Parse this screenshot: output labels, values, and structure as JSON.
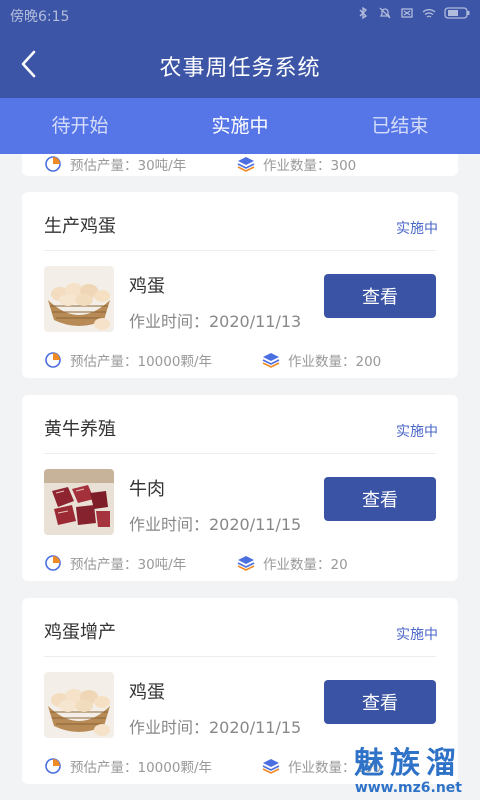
{
  "status_bar": {
    "time": "傍晚6:15"
  },
  "app_bar": {
    "title": "农事周任务系统"
  },
  "tabs": [
    {
      "label": "待开始",
      "active": false
    },
    {
      "label": "实施中",
      "active": true
    },
    {
      "label": "已结束",
      "active": false
    }
  ],
  "partial_card": {
    "yield_label": "预估产量：30吨/年",
    "quantity_label": "作业数量：300"
  },
  "cards": [
    {
      "title": "生产鸡蛋",
      "status": "实施中",
      "item": "鸡蛋",
      "time": "作业时间：2020/11/13",
      "button": "查看",
      "yield": "预估产量：10000颗/年",
      "quantity": "作业数量：200",
      "image": "eggs-in-basket"
    },
    {
      "title": "黄牛养殖",
      "status": "实施中",
      "item": "牛肉",
      "time": "作业时间：2020/11/15",
      "button": "查看",
      "yield": "预估产量：30吨/年",
      "quantity": "作业数量：20",
      "image": "beef-cubes"
    },
    {
      "title": "鸡蛋增产",
      "status": "实施中",
      "item": "鸡蛋",
      "time": "作业时间：2020/11/15",
      "button": "查看",
      "yield": "预估产量：10000颗/年",
      "quantity": "作业数量：100",
      "image": "eggs-in-basket"
    }
  ],
  "watermark": {
    "brand": "魅族溜",
    "url": "www.mz6.net"
  },
  "colors": {
    "header": "#3c55a7",
    "tabs": "#5676e8",
    "button": "#3a53a4",
    "status": "#4a66c8"
  }
}
